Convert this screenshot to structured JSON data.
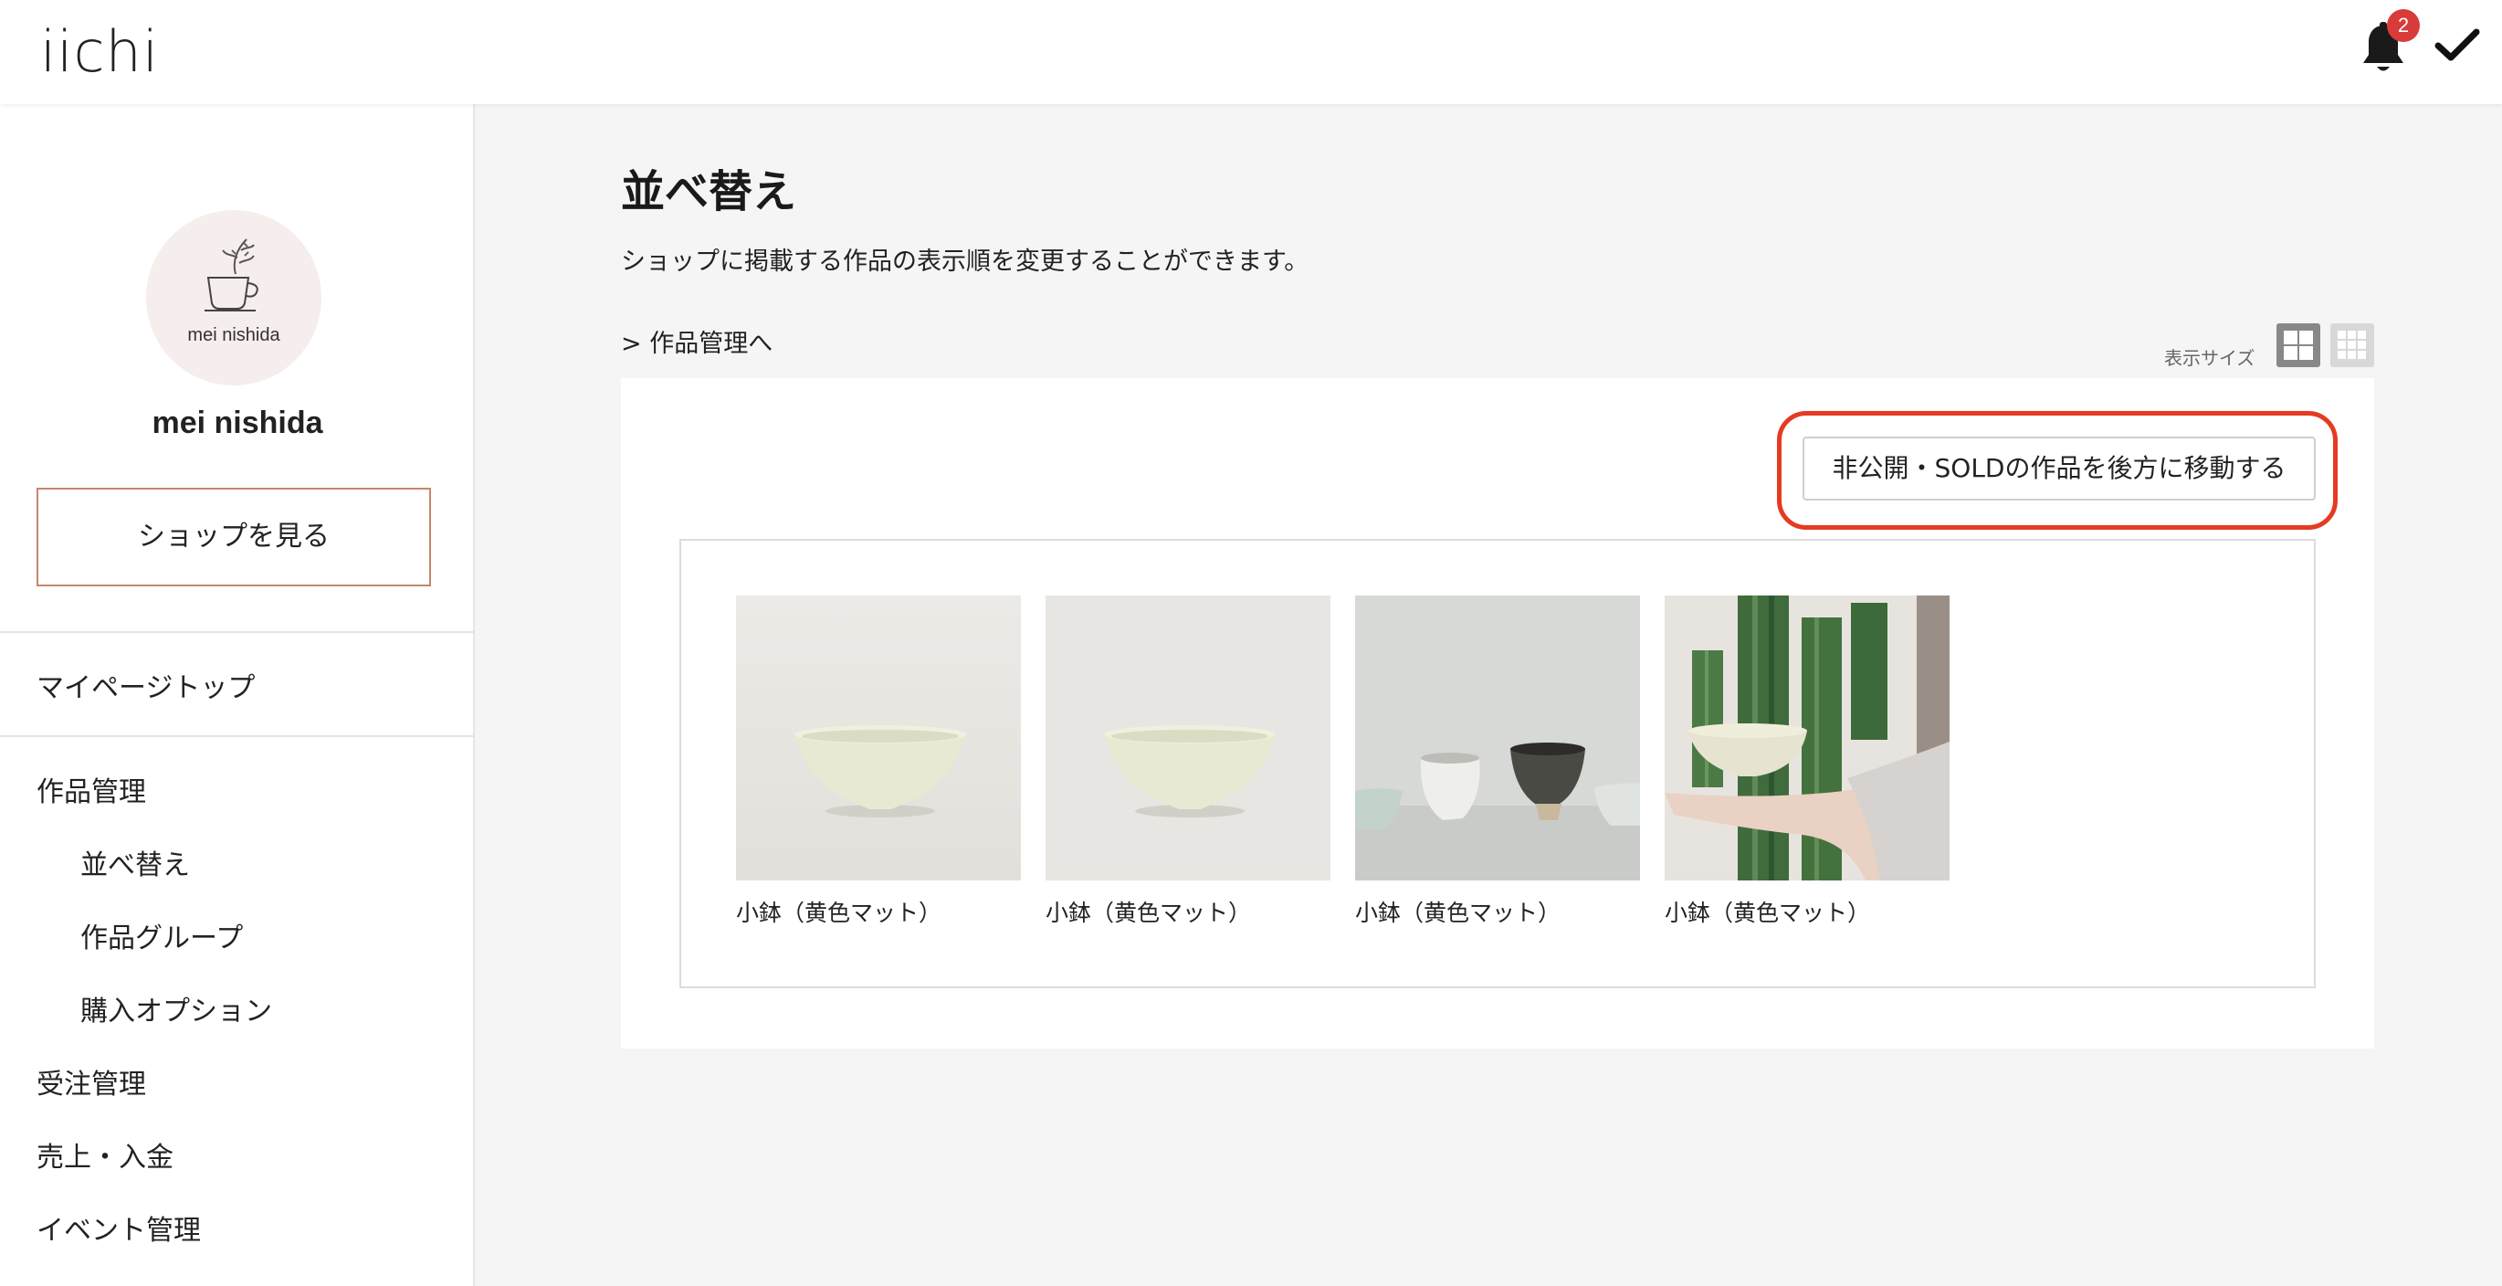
{
  "header": {
    "logo": "iichi",
    "notification_count": "2"
  },
  "sidebar": {
    "avatar_caption": "mei nishida",
    "shop_name": "mei nishida",
    "view_shop_label": "ショップを見る",
    "items": [
      {
        "label": "マイページトップ"
      },
      {
        "label": "作品管理"
      },
      {
        "label": "並べ替え"
      },
      {
        "label": "作品グループ"
      },
      {
        "label": "購入オプション"
      },
      {
        "label": "受注管理"
      },
      {
        "label": "売上・入金"
      },
      {
        "label": "イベント管理"
      }
    ]
  },
  "main": {
    "title": "並べ替え",
    "description": "ショップに掲載する作品の表示順を変更することができます。",
    "manage_link": "> 作品管理へ",
    "display_size_label": "表示サイズ",
    "move_button_label": "非公開・SOLDの作品を後方に移動する",
    "highlight_color": "#e63a23",
    "products": [
      {
        "title": "小鉢（黄色マット）"
      },
      {
        "title": "小鉢（黄色マット）"
      },
      {
        "title": "小鉢（黄色マット）"
      },
      {
        "title": "小鉢（黄色マット）"
      }
    ]
  }
}
